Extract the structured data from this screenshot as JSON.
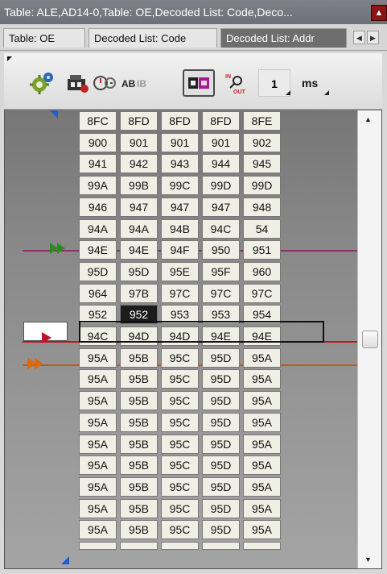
{
  "window": {
    "title": "Table: ALE,AD14-0,Table: OE,Decoded List: Code,Deco...",
    "close_icon": "close-icon"
  },
  "tabs": [
    {
      "label": "Table: OE",
      "active": false
    },
    {
      "label": "Decoded List: Code",
      "active": false
    },
    {
      "label": "Decoded List: Addr",
      "active": true
    }
  ],
  "toolbar": {
    "icons": [
      "gear-plugin-icon",
      "auto-tape-icon",
      "timer-icon",
      "ascii-toggle-icon",
      "display-mode-icon",
      "in-out-search-icon"
    ],
    "step_value": "1",
    "unit": "ms"
  },
  "colors": {
    "marker_line_magenta": "#8b2e6e",
    "marker_line_red": "#c2122d",
    "marker_line_orange": "#c0571c",
    "selected_cell_bg": "#1c1c1c"
  },
  "table": {
    "rows": [
      [
        "8FC",
        "8FD",
        "8FD",
        "8FD",
        "8FE"
      ],
      [
        "900",
        "901",
        "901",
        "901",
        "902"
      ],
      [
        "941",
        "942",
        "943",
        "944",
        "945"
      ],
      [
        "99A",
        "99B",
        "99C",
        "99D",
        "99D"
      ],
      [
        "946",
        "947",
        "947",
        "947",
        "948"
      ],
      [
        "94A",
        "94A",
        "94B",
        "94C",
        "54"
      ],
      [
        "94E",
        "94E",
        "94F",
        "950",
        "951"
      ],
      [
        "95D",
        "95D",
        "95E",
        "95F",
        "960"
      ],
      [
        "964",
        "97B",
        "97C",
        "97C",
        "97C"
      ],
      [
        "952",
        "952",
        "953",
        "953",
        "954"
      ],
      [
        "94C",
        "94D",
        "94D",
        "94E",
        "94E"
      ],
      [
        "95A",
        "95B",
        "95C",
        "95D",
        "95A"
      ],
      [
        "95A",
        "95B",
        "95C",
        "95D",
        "95A"
      ],
      [
        "95A",
        "95B",
        "95C",
        "95D",
        "95A"
      ],
      [
        "95A",
        "95B",
        "95C",
        "95D",
        "95A"
      ],
      [
        "95A",
        "95B",
        "95C",
        "95D",
        "95A"
      ],
      [
        "95A",
        "95B",
        "95C",
        "95D",
        "95A"
      ],
      [
        "95A",
        "95B",
        "95C",
        "95D",
        "95A"
      ],
      [
        "95A",
        "95B",
        "95C",
        "95D",
        "95A"
      ],
      [
        "95A",
        "95B",
        "95C",
        "95D",
        "95A"
      ]
    ],
    "selected_row": 9,
    "selected_col": 1
  },
  "scrollbar": {
    "up_icon": "scroll-up-icon",
    "down_icon": "scroll-down-icon"
  }
}
